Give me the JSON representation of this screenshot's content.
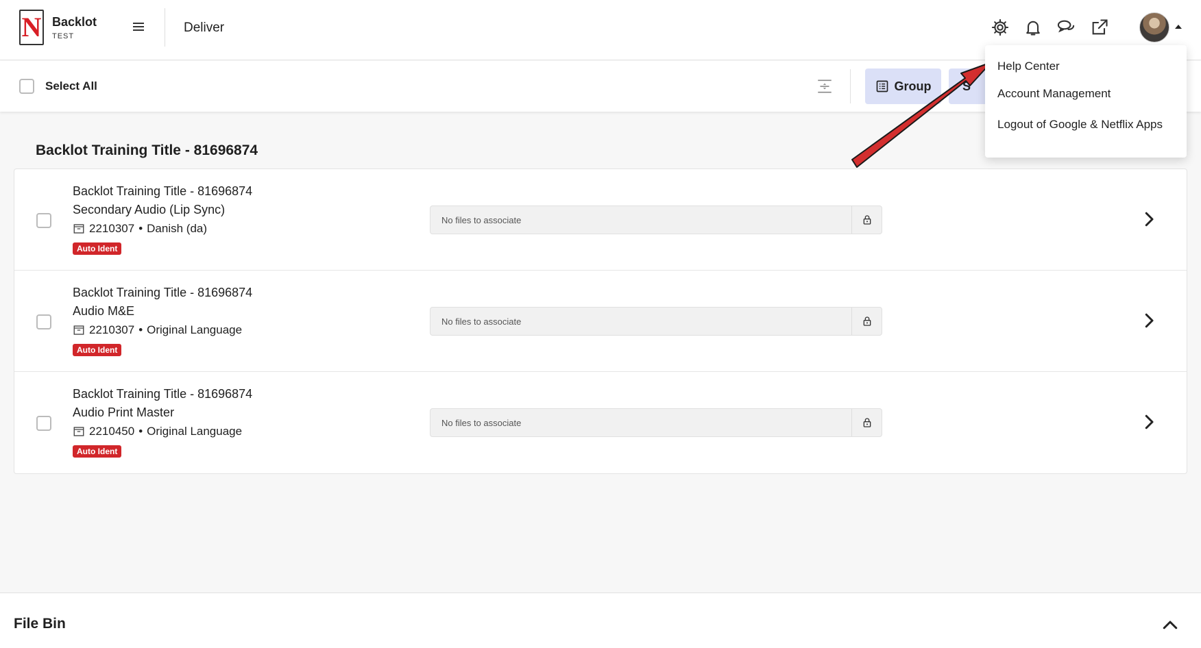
{
  "header": {
    "logo_letter": "N",
    "brand_name": "Backlot",
    "environment": "TEST",
    "page_title": "Deliver",
    "icons": [
      "settings-gear-icon",
      "notification-bell-icon",
      "chat-bubbles-icon",
      "external-link-icon"
    ]
  },
  "toolbar": {
    "select_all_label": "Select All",
    "group_label": "Group",
    "sort_label_visible": "S"
  },
  "group": {
    "title": "Backlot Training Title - 81696874"
  },
  "rows": [
    {
      "title": "Backlot Training Title - 81696874",
      "subtitle": "Secondary Audio (Lip Sync)",
      "id": "2210307",
      "language": "Danish (da)",
      "badge": "Auto Ident",
      "assoc_text": "No files to associate"
    },
    {
      "title": "Backlot Training Title - 81696874",
      "subtitle": "Audio M&E",
      "id": "2210307",
      "language": "Original Language",
      "badge": "Auto Ident",
      "assoc_text": "No files to associate"
    },
    {
      "title": "Backlot Training Title - 81696874",
      "subtitle": "Audio Print Master",
      "id": "2210450",
      "language": "Original Language",
      "badge": "Auto Ident",
      "assoc_text": "No files to associate"
    }
  ],
  "user_menu": {
    "items": [
      "Help Center",
      "Account Management",
      "Logout of Google & Netflix Apps"
    ]
  },
  "file_bin": {
    "title": "File Bin"
  },
  "colors": {
    "brand_red": "#d81f26",
    "badge_red": "#d1262a",
    "button_bg": "#dbe0f7",
    "annotation_arrow": "#d32f2f"
  }
}
